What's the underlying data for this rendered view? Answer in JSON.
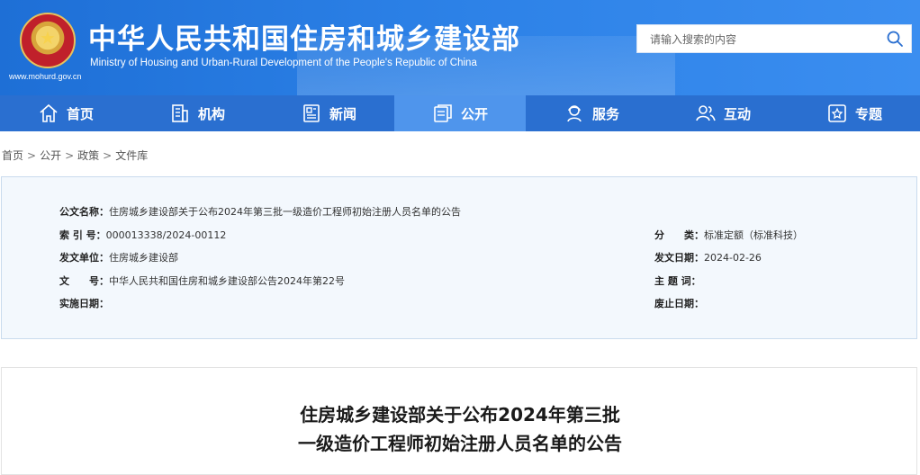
{
  "header": {
    "title": "中华人民共和国住房和城乡建设部",
    "subtitle": "Ministry of Housing and Urban-Rural Development of the People's Republic of China",
    "url": "www.mohurd.gov.cn",
    "search_placeholder": "请输入搜索的内容"
  },
  "nav": [
    {
      "label": "首页",
      "icon": "home-icon"
    },
    {
      "label": "机构",
      "icon": "building-icon"
    },
    {
      "label": "新闻",
      "icon": "newspaper-icon"
    },
    {
      "label": "公开",
      "icon": "document-icon",
      "active": true
    },
    {
      "label": "服务",
      "icon": "service-icon"
    },
    {
      "label": "互动",
      "icon": "people-icon"
    },
    {
      "label": "专题",
      "icon": "star-icon"
    }
  ],
  "breadcrumb": [
    "首页",
    "公开",
    "政策",
    "文件库"
  ],
  "breadcrumb_sep": ">",
  "meta": {
    "name_label": "公文名称：",
    "name_value": "住房城乡建设部关于公布2024年第三批一级造价工程师初始注册人员名单的公告",
    "index_label": "索 引 号：",
    "index_value": "000013338/2024-00112",
    "category_label": "分　　类：",
    "category_value": "标准定额（标准科技）",
    "unit_label": "发文单位：",
    "unit_value": "住房城乡建设部",
    "date_label": "发文日期：",
    "date_value": "2024-02-26",
    "docno_label": "文　　号：",
    "docno_value": "中华人民共和国住房和城乡建设部公告2024年第22号",
    "keywords_label": "主 题 词：",
    "keywords_value": "",
    "effective_label": "实施日期：",
    "effective_value": "",
    "abolish_label": "废止日期：",
    "abolish_value": ""
  },
  "article": {
    "title_line1": "住房城乡建设部关于公布2024年第三批",
    "title_line2": "一级造价工程师初始注册人员名单的公告"
  },
  "colors": {
    "header_blue": "#2b80e6",
    "nav_blue": "#2a6fd0",
    "nav_active": "#4f95ec",
    "meta_bg": "#f3f8fd"
  }
}
